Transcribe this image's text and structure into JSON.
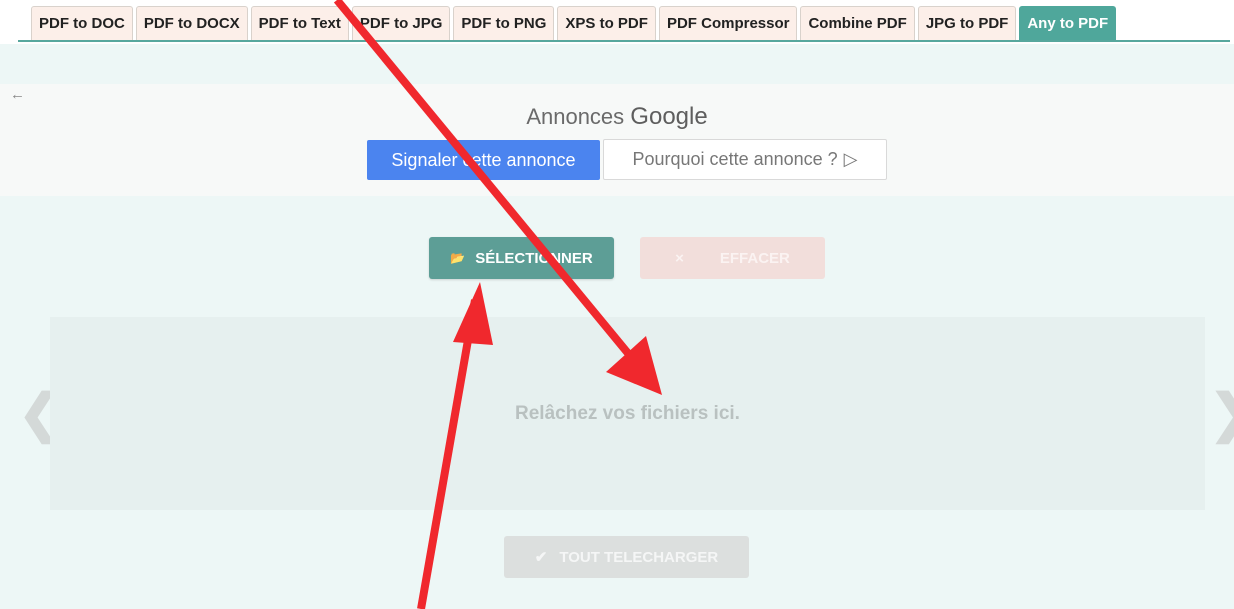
{
  "tabs": [
    {
      "label": "PDF to DOC",
      "active": false
    },
    {
      "label": "PDF to DOCX",
      "active": false
    },
    {
      "label": "PDF to Text",
      "active": false
    },
    {
      "label": "PDF to JPG",
      "active": false
    },
    {
      "label": "PDF to PNG",
      "active": false
    },
    {
      "label": "XPS to PDF",
      "active": false
    },
    {
      "label": "PDF Compressor",
      "active": false
    },
    {
      "label": "Combine PDF",
      "active": false
    },
    {
      "label": "JPG to PDF",
      "active": false
    },
    {
      "label": "Any to PDF",
      "active": true
    }
  ],
  "ad": {
    "annonces": "Annonces",
    "google": "Google",
    "report_button": "Signaler cette annonce",
    "why_button": "Pourquoi cette annonce ?",
    "why_icon": "▷"
  },
  "uploader": {
    "select_icon": "📂",
    "select_label": "SÉLECTIONNER",
    "clear_icon": "×",
    "clear_label": "EFFACER",
    "drop_text": "Relâchez vos fichiers ici.",
    "download_icon": "✔",
    "download_label": "TOUT TELECHARGER",
    "prev_icon": "❮",
    "next_icon": "❯",
    "back_icon": "←"
  },
  "colors": {
    "accent": "#4fa79b",
    "annotation_arrow": "#f0282d",
    "ad_blue": "#4b84ef"
  }
}
